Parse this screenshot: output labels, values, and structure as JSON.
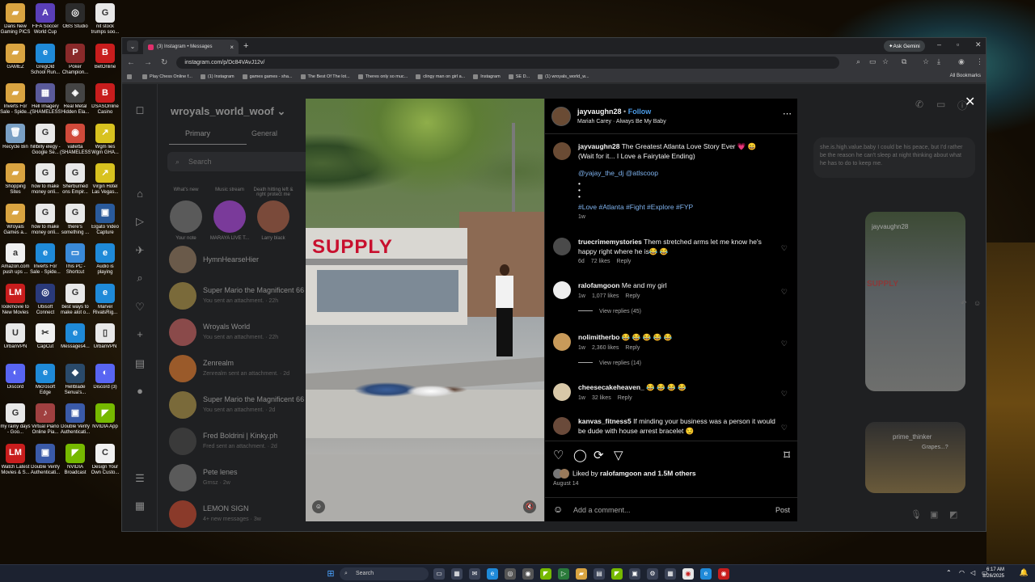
{
  "desktop": {
    "icons": [
      {
        "label": "Dans New Gaming PICS",
        "color": "#d9a441",
        "glyph": "▰"
      },
      {
        "label": "FIFA Soccer World Cup",
        "color": "#5a3fb8",
        "glyph": "A"
      },
      {
        "label": "OBS Studio",
        "color": "#2b2b2b",
        "glyph": "◎"
      },
      {
        "label": "nit stock trumps soo...",
        "color": "#e8e8e8",
        "glyph": "G"
      },
      {
        "label": "GAMEZ",
        "color": "#d9a441",
        "glyph": "▰"
      },
      {
        "label": "GregOld School Run...",
        "color": "#1f8ad8",
        "glyph": "e"
      },
      {
        "label": "Poker Champion...",
        "color": "#8a2a2a",
        "glyph": "P"
      },
      {
        "label": "BetOnline",
        "color": "#c81d1d",
        "glyph": "B"
      },
      {
        "label": "Inverts For Sale - Spide...",
        "color": "#d9a441",
        "glyph": "▰"
      },
      {
        "label": "Hell Imagery (SHAMELESS)",
        "color": "#5a5a9a",
        "glyph": "▦"
      },
      {
        "label": "Real Metal Hidden Ela...",
        "color": "#444",
        "glyph": "◈"
      },
      {
        "label": "DSASOnline Casino Gam...",
        "color": "#c81d1d",
        "glyph": "B"
      },
      {
        "label": "Recycle Bin",
        "color": "#7aa0c4",
        "glyph": "🗑"
      },
      {
        "label": "hillbilly elegy - Google Se...",
        "color": "#e8e8e8",
        "glyph": "G"
      },
      {
        "label": "valletta (SHAMELESS)",
        "color": "#d04a3a",
        "glyph": "◉"
      },
      {
        "label": "Wgm lies Wgm GHA...",
        "color": "#d8c21f",
        "glyph": "↗"
      },
      {
        "label": "Shopping Sites",
        "color": "#d9a441",
        "glyph": "▰"
      },
      {
        "label": "how to make money onli...",
        "color": "#e8e8e8",
        "glyph": "G"
      },
      {
        "label": "Sherburned ons Empir...",
        "color": "#e8e8e8",
        "glyph": "G"
      },
      {
        "label": "Virgin Hotel Las Vegas...",
        "color": "#d8c21f",
        "glyph": "↗"
      },
      {
        "label": "Wroyals Games a...",
        "color": "#d9a441",
        "glyph": "▰"
      },
      {
        "label": "how to make money onli...",
        "color": "#e8e8e8",
        "glyph": "G"
      },
      {
        "label": "there's something ...",
        "color": "#e8e8e8",
        "glyph": "G"
      },
      {
        "label": "Elgato Video Capture",
        "color": "#2a5a9a",
        "glyph": "▣"
      },
      {
        "label": "Amazon.com push ups ...",
        "color": "#f0f0f0",
        "glyph": "a"
      },
      {
        "label": "Inverts For Sale - Spide...",
        "color": "#1f8ad8",
        "glyph": "e"
      },
      {
        "label": "This PC - Shortcut",
        "color": "#3a8ad8",
        "glyph": "▭"
      },
      {
        "label": "Audio is playing",
        "color": "#1f8ad8",
        "glyph": "e"
      },
      {
        "label": "lookmovie to New Movies",
        "color": "#c81d1d",
        "glyph": "LM"
      },
      {
        "label": "Ubisoft Connect",
        "color": "#2a3a7a",
        "glyph": "◎"
      },
      {
        "label": "best ways to make alot o...",
        "color": "#e8e8e8",
        "glyph": "G"
      },
      {
        "label": "Marvel RivalsRig...",
        "color": "#1f8ad8",
        "glyph": "e"
      },
      {
        "label": "UrbanVPN",
        "color": "#e8e8e8",
        "glyph": "U"
      },
      {
        "label": "CapCut",
        "color": "#f0f0f0",
        "glyph": "✂"
      },
      {
        "label": "Messages4...",
        "color": "#1f8ad8",
        "glyph": "e"
      },
      {
        "label": "UrbanVPN",
        "color": "#e8e8e8",
        "glyph": "▯"
      },
      {
        "label": "Discord",
        "color": "#5865f2",
        "glyph": "◐"
      },
      {
        "label": "Microsoft Edge",
        "color": "#1f8ad8",
        "glyph": "e"
      },
      {
        "label": "Hellblade Senua's...",
        "color": "#2a4a6a",
        "glyph": "◆"
      },
      {
        "label": "Discord (3)",
        "color": "#5865f2",
        "glyph": "◐"
      },
      {
        "label": "my rainy days - Goo...",
        "color": "#e8e8e8",
        "glyph": "G"
      },
      {
        "label": "Virtual Piano Online Pia...",
        "color": "#a04040",
        "glyph": "♪"
      },
      {
        "label": "Double Verify Authenticati...",
        "color": "#3a5aa8",
        "glyph": "▣"
      },
      {
        "label": "NVIDIA App",
        "color": "#76b900",
        "glyph": "◤"
      },
      {
        "label": "Watch Latest Movies & S...",
        "color": "#c81d1d",
        "glyph": "LM"
      },
      {
        "label": "Double Verify Authenticati...",
        "color": "#3a5aa8",
        "glyph": "▣"
      },
      {
        "label": "NVIDIA Broadcast",
        "color": "#76b900",
        "glyph": "◤"
      },
      {
        "label": "Design Your Own Custo...",
        "color": "#f0f0f0",
        "glyph": "C"
      }
    ]
  },
  "browser": {
    "tab_title": "(3) Instagram • Messages",
    "gemini": "Ask Gemini",
    "url": "instagram.com/p/Dc84VAvJ12v/",
    "bookmarks": [
      "Play Chess Online f...",
      "(1) Instagram",
      "games games - sha...",
      "The Best Of The lot...",
      "Theres only so muc...",
      "clingy man on girl a...",
      "Instagram",
      "SE D...",
      "(1) wroyals_world_w..."
    ],
    "all_bookmarks": "All Bookmarks"
  },
  "instagram": {
    "username": "wroyals_world_woof",
    "tabs": {
      "primary": "Primary",
      "general": "General"
    },
    "search_placeholder": "Search",
    "notes": [
      {
        "bubble": "What's new",
        "name": "Your note"
      },
      {
        "bubble": "Music stream",
        "name": "MARAYA LIVE T..."
      },
      {
        "bubble": "Death hitting left & right protect me",
        "name": "Larry black"
      }
    ],
    "chats": [
      {
        "name": "HymnHearseHier",
        "sub": ""
      },
      {
        "name": "Super Mario the Magnificent 66",
        "sub": "You sent an attachment. · 22h"
      },
      {
        "name": "Wroyals World",
        "sub": "You sent an attachment. · 22h"
      },
      {
        "name": "Zenrealm",
        "sub": "Zenrealm sent an attachment. · 2d"
      },
      {
        "name": "Super Mario the Magnificent 66",
        "sub": "You sent an attachment. · 2d"
      },
      {
        "name": "Fred Boldrini | Kinky.ph",
        "sub": "Fred sent an attachment. · 2d"
      },
      {
        "name": "Pete lenes",
        "sub": "Grnsz · 2w"
      },
      {
        "name": "LEMON SIGN",
        "sub": "4+ new messages · 3w"
      }
    ],
    "right_pane": {
      "message": "she.is.high.value.baby I could be his peace, but I'd rather be the reason he can't sleep at night thinking about what he has to do to keep me.",
      "thumb1_user": "jayvaughn28",
      "thumb2_user": "prime_thinker",
      "thumb2_caption": "Grapes...?"
    }
  },
  "post": {
    "sign_text": "SUPPLY",
    "author": "jayvaughn28",
    "follow": "Follow",
    "audio": "Mariah Carey · Always Be My Baby",
    "caption_title": "The Greatest Atlanta Love Story Ever 💗 😄",
    "caption_line2": "(Wait for it... I Love a Fairytale Ending)",
    "mentions": "@yajay_the_dj @atlscoop",
    "dots": [
      "•",
      "•",
      "•"
    ],
    "hashtags": "#Love #Atlanta #Fight #Explore #FYP",
    "caption_age": "1w",
    "comments": [
      {
        "user": "truecrimemystories",
        "text": "Them stretched arms let me know he's happy right where he is😂 😂",
        "age": "6d",
        "likes": "72 likes",
        "reply": "Reply",
        "view": ""
      },
      {
        "user": "ralofamgoon",
        "text": "Me and my girl",
        "age": "1w",
        "likes": "1,077 likes",
        "reply": "Reply",
        "view": "View replies (45)"
      },
      {
        "user": "nolimitherbo",
        "text": "😂 😂 😂 😂 😂",
        "age": "1w",
        "likes": "2,360 likes",
        "reply": "Reply",
        "view": "View replies (14)"
      },
      {
        "user": "cheesecakeheaven_",
        "text": "😂 😂 😂 😂",
        "age": "1w",
        "likes": "32 likes",
        "reply": "Reply",
        "view": ""
      },
      {
        "user": "kanvas_fitness5",
        "text": "If minding your business was a person it would be dude with house arrest bracelet 😏",
        "age": "",
        "likes": "",
        "reply": "",
        "view": ""
      }
    ],
    "liked_by": "Liked by",
    "liked_user": "ralofamgoon",
    "liked_rest": "and 1.5M others",
    "date": "August 14",
    "add_comment": "Add a comment...",
    "post_button": "Post"
  },
  "taskbar": {
    "search": "Search",
    "time": "6:17 AM",
    "date": "8/26/2025"
  }
}
